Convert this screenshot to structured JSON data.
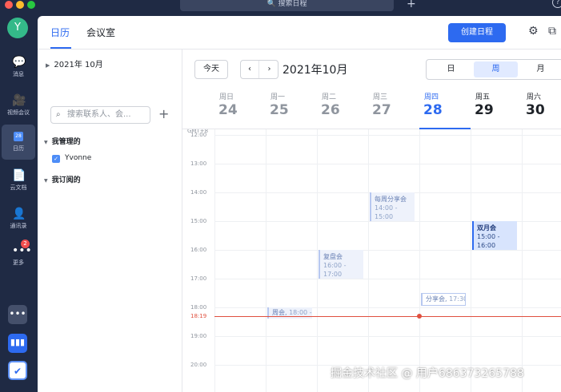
{
  "titlebar": {
    "search_label": "🔍 搜索日程",
    "plus": "+",
    "help": "?"
  },
  "rail": {
    "avatar": "Y",
    "items": [
      {
        "label": "消息",
        "icon": "chat-icon",
        "glyph": "💬"
      },
      {
        "label": "视频会议",
        "icon": "video-icon",
        "glyph": "🎥"
      },
      {
        "label": "日历",
        "icon": "calendar-icon",
        "glyph": "28"
      },
      {
        "label": "云文档",
        "icon": "doc-icon",
        "glyph": "📄"
      },
      {
        "label": "通讯录",
        "icon": "contacts-icon",
        "glyph": "👤"
      },
      {
        "label": "更多",
        "icon": "more-icon",
        "glyph": "•••",
        "badge": "2"
      }
    ],
    "bottom": [
      "•••",
      "▮▮▮",
      "✔"
    ]
  },
  "header": {
    "tabs": [
      "日历",
      "会议室"
    ],
    "create_button": "创建日程"
  },
  "sidebar": {
    "month": "2021年 10月",
    "search_placeholder": "搜索联系人、会...",
    "managed_group": "我管理的",
    "calendar_name": "Yvonne",
    "subscribed_group": "我订阅的"
  },
  "toolbar": {
    "today": "今天",
    "prev": "‹",
    "next": "›",
    "title": "2021年10月",
    "views": [
      "日",
      "周",
      "月"
    ],
    "active_view": "周"
  },
  "timezone": "GMT+8",
  "days": [
    {
      "weekday": "周日",
      "date": "24"
    },
    {
      "weekday": "周一",
      "date": "25"
    },
    {
      "weekday": "周二",
      "date": "26"
    },
    {
      "weekday": "周三",
      "date": "27"
    },
    {
      "weekday": "周四",
      "date": "28"
    },
    {
      "weekday": "周五",
      "date": "29"
    },
    {
      "weekday": "周六",
      "date": "30"
    }
  ],
  "hours": [
    "12:00",
    "13:00",
    "14:00",
    "15:00",
    "16:00",
    "17:00",
    "18:00",
    "19:00",
    "20:00"
  ],
  "now": "18:19",
  "events": [
    {
      "title": "每周分享会",
      "time": "14:00 -",
      "end": "15:00"
    },
    {
      "title": "双月会",
      "time": "15:00 -",
      "end": "16:00"
    },
    {
      "title": "复盘会",
      "time": "16:00 -",
      "end": "17:00"
    },
    {
      "title": "分享会,",
      "time": "17:30"
    },
    {
      "title": "周会,",
      "time": "18:00 -"
    }
  ],
  "watermark": "掘金技术社区 @ 用户686373265788"
}
